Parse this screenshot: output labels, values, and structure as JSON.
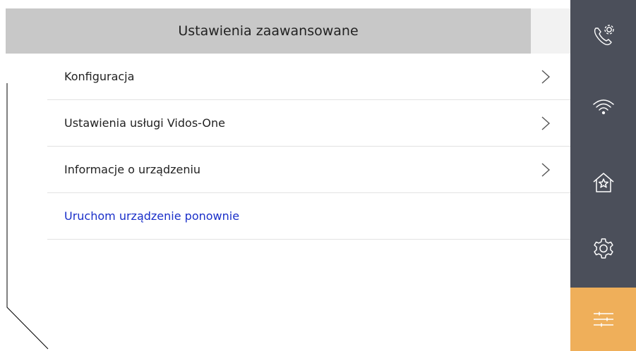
{
  "header": {
    "title": "Ustawienia zaawansowane"
  },
  "menu": {
    "items": [
      {
        "label": "Konfiguracja",
        "has_chevron": true
      },
      {
        "label": "Ustawienia usługi Vidos-One",
        "has_chevron": true
      },
      {
        "label": "Informacje o urządzeniu",
        "has_chevron": true
      },
      {
        "label": "Uruchom urządzenie ponownie",
        "has_chevron": false
      }
    ]
  },
  "sidebar": {
    "items": [
      {
        "icon": "call-settings-icon",
        "active": false
      },
      {
        "icon": "wifi-icon",
        "active": false
      },
      {
        "icon": "home-star-icon",
        "active": false
      },
      {
        "icon": "gear-icon",
        "active": false
      },
      {
        "icon": "sliders-icon",
        "active": true
      }
    ]
  },
  "colors": {
    "sidebar_bg": "#4b4f5a",
    "active_bg": "#efaf5a",
    "header_bg": "#c8c8c8",
    "link_text": "#1a2fc9"
  }
}
